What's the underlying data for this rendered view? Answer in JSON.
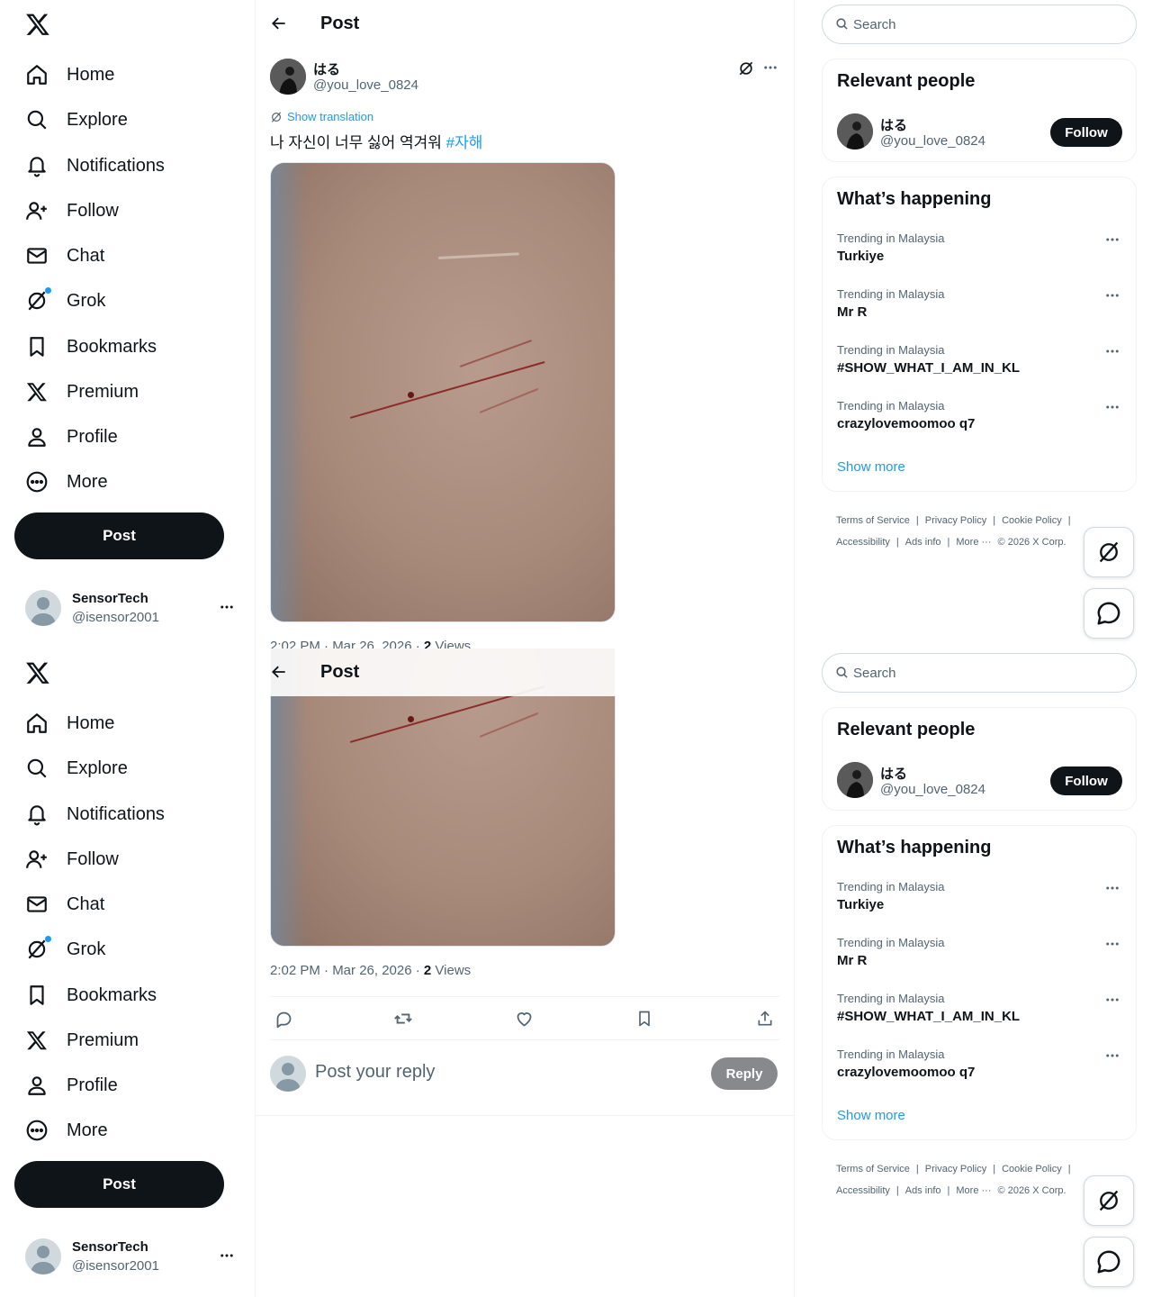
{
  "nav": {
    "items": [
      {
        "label": "Home",
        "icon": "home-icon"
      },
      {
        "label": "Explore",
        "icon": "search-icon"
      },
      {
        "label": "Notifications",
        "icon": "bell-icon"
      },
      {
        "label": "Follow",
        "icon": "add-user-icon"
      },
      {
        "label": "Chat",
        "icon": "envelope-icon"
      },
      {
        "label": "Grok",
        "icon": "grok-icon"
      },
      {
        "label": "Bookmarks",
        "icon": "bookmark-icon"
      },
      {
        "label": "Premium",
        "icon": "x-logo-icon"
      },
      {
        "label": "Profile",
        "icon": "person-icon"
      },
      {
        "label": "More",
        "icon": "more-circle-icon"
      }
    ],
    "post_label": "Post"
  },
  "account": {
    "name": "SensorTech",
    "handle": "@isensor2001"
  },
  "header": {
    "title": "Post"
  },
  "tweet": {
    "author_name": "はる",
    "author_handle": "@you_love_0824",
    "show_translation": "Show translation",
    "text": "나 자신이 너무 싫어  역겨워 ",
    "hashtag": "#자해",
    "time": "2:02 PM · Mar 26, 2026 · ",
    "views_count": "2",
    "views_label": " Views"
  },
  "reply": {
    "placeholder": "Post your reply",
    "button": "Reply"
  },
  "sidebar": {
    "search_placeholder": "Search",
    "relevant_title": "Relevant people",
    "person": {
      "name": "はる",
      "handle": "@you_love_0824",
      "follow": "Follow"
    },
    "trends_title": "What’s happening",
    "trends": [
      {
        "context": "Trending in Malaysia",
        "topic": "Turkiye"
      },
      {
        "context": "Trending in Malaysia",
        "topic": "Mr R"
      },
      {
        "context": "Trending in Malaysia",
        "topic": "#SHOW_WHAT_I_AM_IN_KL"
      },
      {
        "context": "Trending in Malaysia",
        "topic": "crazylovemoomoo q7"
      }
    ],
    "show_more": "Show more",
    "footer": {
      "terms": "Terms of Service",
      "privacy": "Privacy Policy",
      "cookie": "Cookie Policy",
      "accessibility": "Accessibility",
      "ads": "Ads info",
      "more": "More ···",
      "copyright": "© 2026 X Corp."
    }
  },
  "colors": {
    "accent": "#1d9bf0",
    "text": "#0f1419",
    "muted": "#536471",
    "border": "#eff3f4"
  }
}
